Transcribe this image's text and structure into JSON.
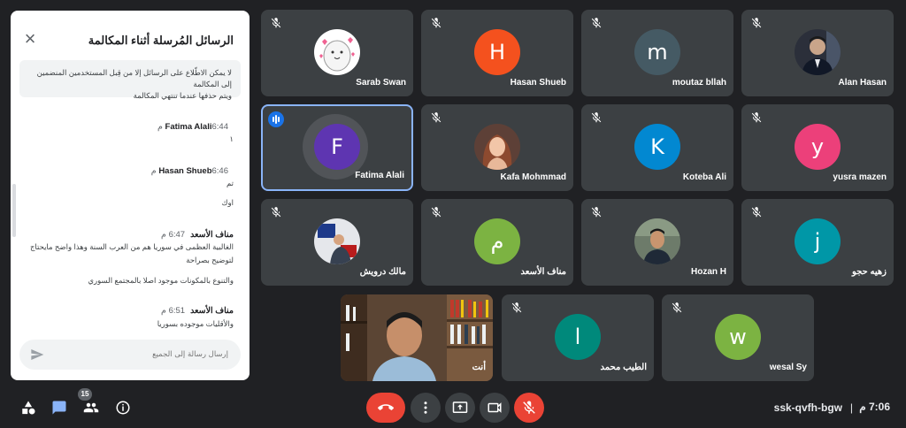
{
  "chat": {
    "title": "الرسائل المُرسلة أثناء المكالمة",
    "notice_line1": "لا يمكن الاطّلاع على الرسائل إلا من قِبل المستخدمين المنضمين إلى المكالمة",
    "notice_line2": "ويتم حذفها عندما تنتهي المكالمة",
    "input_placeholder": "إرسال رسالة إلى الجميع",
    "messages": [
      {
        "sender": "Fatima Alali",
        "time": "6:44 م",
        "lines": [
          "١"
        ]
      },
      {
        "sender": "Hasan Shueb",
        "time": "6:46 م",
        "lines": [
          "تم",
          "اوك"
        ]
      },
      {
        "sender": "مناف الأسعد",
        "time": "6:47 م",
        "lines": [
          "الغالبية العظمى في سوريا هم من العرب السنة وهذا واضح مايحتاج",
          "لتوضيح بصراحة",
          "والتنوع بالمكونات موجود اصلا بالمجتمع السوري"
        ]
      },
      {
        "sender": "مناف الأسعد",
        "time": "6:51 م",
        "lines": [
          "والأقليات موجوده بسوريا"
        ]
      }
    ]
  },
  "participants": [
    {
      "name": "Alan Hasan",
      "type": "photo",
      "icon": "person-photo"
    },
    {
      "name": "moutaz bllah",
      "type": "letter",
      "letter": "m",
      "color": "#455a64"
    },
    {
      "name": "Hasan Shueb",
      "type": "letter",
      "letter": "H",
      "color": "#f4511e"
    },
    {
      "name": "Sarab Swan",
      "type": "photo",
      "icon": "cartoon-avatar"
    },
    {
      "name": "yusra mazen",
      "type": "letter",
      "letter": "y",
      "color": "#ec407a"
    },
    {
      "name": "Koteba Ali",
      "type": "letter",
      "letter": "K",
      "color": "#0288d1"
    },
    {
      "name": "Kafa Mohmmad",
      "type": "photo",
      "icon": "person-photo"
    },
    {
      "name": "Fatima Alali",
      "type": "letter",
      "letter": "F",
      "color": "#5e35b1",
      "speaking": true
    },
    {
      "name": "زهيه حجو",
      "type": "letter",
      "letter": "j",
      "color": "#0097a7"
    },
    {
      "name": "Hozan H",
      "type": "photo",
      "icon": "person-photo"
    },
    {
      "name": "مناف الأسعد",
      "type": "letter",
      "letter": "م",
      "color": "#7cb342"
    },
    {
      "name": "مالك درويش",
      "type": "photo",
      "icon": "person-photo"
    },
    {
      "name": "wesal Sy",
      "type": "letter",
      "letter": "w",
      "color": "#7cb342"
    },
    {
      "name": "الطيب محمد",
      "type": "letter",
      "letter": "l",
      "color": "#00897b"
    },
    {
      "name": "أنت",
      "type": "video",
      "icon": "self-video"
    }
  ],
  "toolbar": {
    "people_count": "15",
    "meeting_code": "ssk-qvfh-bgw",
    "separator": "|",
    "clock": "7:06 م"
  },
  "colors": {
    "end_call": "#ea4335",
    "accent": "#1a73e8",
    "tile": "#3c4043",
    "background": "#202124"
  }
}
